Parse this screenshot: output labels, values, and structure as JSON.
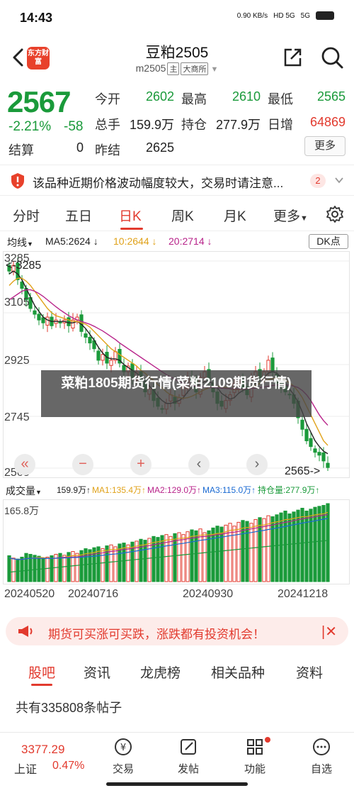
{
  "status_bar": {
    "time": "14:43",
    "net_speed": "0.90 KB/s",
    "signal1": "HD 5G",
    "signal2": "5G"
  },
  "header": {
    "logo_text": "东方财富",
    "title": "豆粕2505",
    "code": "m2505",
    "tag1": "主",
    "tag2": "大商所"
  },
  "quote": {
    "price": "2567",
    "change_pct": "-2.21%",
    "change_abs": "-58",
    "settle_label": "结算",
    "settle_value": "0",
    "open_label": "今开",
    "open_value": "2602",
    "high_label": "最高",
    "high_value": "2610",
    "low_label": "最低",
    "low_value": "2565",
    "volume_label": "总手",
    "volume_value": "159.9万",
    "oi_label": "持仓",
    "oi_value": "277.9万",
    "daily_inc_label": "日增",
    "daily_inc_value": "64869",
    "prev_settle_label": "昨结",
    "prev_settle_value": "2625",
    "more_label": "更多"
  },
  "notice": {
    "text": "该品种近期价格波动幅度较大，交易时请注意...",
    "badge": "2"
  },
  "period_tabs": [
    "分时",
    "五日",
    "日K",
    "周K",
    "月K",
    "更多"
  ],
  "period_active": 2,
  "ma_bar": {
    "type": "均线",
    "ma5": "MA5:2624 ↓",
    "ma10": "10:2644 ↓",
    "ma20": "20:2714 ↓",
    "dk": "DK点"
  },
  "kline_labels": {
    "max_marker": "<-3285",
    "min_marker": "2565->",
    "y_ticks": [
      "3285",
      "3105",
      "2925",
      "2745",
      "2565"
    ]
  },
  "overlay_title": "菜粕1805期货行情(菜粕2109期货行情)",
  "volume_bar": {
    "type": "成交量",
    "vol": "159.9万↑",
    "ma1": "MA1:135.4万↑",
    "ma2": "MA2:129.0万↑",
    "ma3": "MA3:115.0万↑",
    "oi": "持仓量:277.9万↑",
    "max_label": "165.8万"
  },
  "x_ticks": [
    "20240520",
    "20240716",
    "20240930",
    "20241218"
  ],
  "colors": {
    "up": "#e23a2e",
    "down": "#1a9a3a",
    "ma5": "#222222",
    "ma10": "#e0a21a",
    "ma20": "#b8238a"
  },
  "promo": {
    "text": "期货可买涨可买跌，涨跌都有投资机会！"
  },
  "content_tabs": [
    "股吧",
    "资讯",
    "龙虎榜",
    "相关品种",
    "资料"
  ],
  "content_active": 0,
  "posts_count": "共有335808条帖子",
  "tabbar": {
    "index_value": "3377.29",
    "index_name": "上证",
    "index_pct": "0.47%",
    "items": [
      {
        "label": "交易",
        "icon": "trade-icon"
      },
      {
        "label": "发帖",
        "icon": "edit-icon"
      },
      {
        "label": "功能",
        "icon": "grid-icon"
      },
      {
        "label": "自选",
        "icon": "chat-icon"
      }
    ]
  },
  "chart_data": {
    "type": "candlestick",
    "title": "",
    "x_ticks": [
      "20240520",
      "20240716",
      "20240930",
      "20241218"
    ],
    "y_ticks": [
      3285,
      3105,
      2925,
      2745,
      2565
    ],
    "ylim": [
      2565,
      3285
    ],
    "close": [
      3250,
      3270,
      3220,
      3190,
      3150,
      3120,
      3100,
      3080,
      3070,
      3090,
      3060,
      3080,
      3070,
      3080,
      3060,
      3080,
      3090,
      3040,
      3020,
      3000,
      2980,
      2940,
      2960,
      2930,
      2940,
      2970,
      2930,
      2900,
      2920,
      2880,
      2900,
      2860,
      2830,
      2840,
      2800,
      2780,
      2770,
      2790,
      2820,
      2790,
      2810,
      2850,
      2880,
      2870,
      2830,
      2880,
      2900,
      2870,
      2830,
      2790,
      2780,
      2800,
      2820,
      2860,
      2870,
      2840,
      2820,
      2880,
      2900,
      2880,
      2900,
      2940,
      2900,
      2860,
      2850,
      2830,
      2820,
      2790,
      2740,
      2700,
      2660,
      2640,
      2620,
      2610,
      2590,
      2567
    ],
    "ma_series": [
      {
        "name": "MA5",
        "values": [
          3240,
          3250,
          3240,
          3220,
          3190,
          3160,
          3130,
          3110,
          3090,
          3080,
          3075,
          3075,
          3075,
          3075,
          3070,
          3070,
          3075,
          3065,
          3050,
          3030,
          3010,
          2985,
          2965,
          2950,
          2945,
          2945,
          2940,
          2925,
          2915,
          2905,
          2895,
          2880,
          2865,
          2850,
          2835,
          2815,
          2800,
          2790,
          2790,
          2795,
          2800,
          2810,
          2830,
          2845,
          2850,
          2860,
          2865,
          2865,
          2860,
          2845,
          2825,
          2815,
          2805,
          2810,
          2825,
          2835,
          2840,
          2850,
          2860,
          2870,
          2880,
          2895,
          2900,
          2895,
          2880,
          2860,
          2840,
          2820,
          2795,
          2760,
          2720,
          2690,
          2660,
          2640,
          2624,
          2615
        ]
      },
      {
        "name": "MA10",
        "values": [
          3200,
          3215,
          3225,
          3225,
          3215,
          3200,
          3180,
          3160,
          3140,
          3120,
          3105,
          3095,
          3090,
          3085,
          3080,
          3075,
          3075,
          3070,
          3065,
          3055,
          3040,
          3025,
          3010,
          2995,
          2980,
          2970,
          2960,
          2950,
          2940,
          2930,
          2920,
          2905,
          2895,
          2880,
          2870,
          2855,
          2845,
          2830,
          2820,
          2815,
          2810,
          2808,
          2810,
          2815,
          2822,
          2830,
          2838,
          2845,
          2850,
          2850,
          2848,
          2845,
          2840,
          2838,
          2838,
          2840,
          2842,
          2846,
          2852,
          2860,
          2866,
          2872,
          2876,
          2878,
          2876,
          2870,
          2862,
          2850,
          2832,
          2810,
          2780,
          2750,
          2720,
          2690,
          2660,
          2644
        ]
      },
      {
        "name": "MA20",
        "values": [
          3150,
          3160,
          3170,
          3180,
          3185,
          3185,
          3180,
          3172,
          3162,
          3150,
          3138,
          3126,
          3115,
          3105,
          3095,
          3087,
          3080,
          3075,
          3070,
          3065,
          3058,
          3050,
          3042,
          3032,
          3022,
          3012,
          3000,
          2990,
          2980,
          2970,
          2960,
          2950,
          2940,
          2930,
          2920,
          2910,
          2900,
          2890,
          2882,
          2874,
          2866,
          2860,
          2856,
          2852,
          2850,
          2848,
          2847,
          2846,
          2845,
          2844,
          2843,
          2842,
          2841,
          2840,
          2840,
          2840,
          2841,
          2842,
          2843,
          2845,
          2847,
          2850,
          2852,
          2854,
          2855,
          2855,
          2853,
          2850,
          2845,
          2835,
          2820,
          2800,
          2775,
          2750,
          2730,
          2714
        ]
      }
    ],
    "volume": [
      55,
      50,
      48,
      52,
      60,
      58,
      56,
      54,
      50,
      52,
      55,
      58,
      60,
      56,
      62,
      64,
      60,
      66,
      70,
      68,
      72,
      74,
      70,
      76,
      78,
      74,
      80,
      82,
      78,
      84,
      86,
      90,
      88,
      92,
      96,
      94,
      98,
      100,
      96,
      102,
      104,
      100,
      106,
      110,
      108,
      112,
      104,
      108,
      114,
      118,
      116,
      120,
      124,
      118,
      126,
      130,
      128,
      124,
      132,
      136,
      134,
      140,
      138,
      142,
      146,
      150,
      144,
      148,
      152,
      156,
      150,
      154,
      158,
      160,
      162,
      165.8
    ]
  }
}
